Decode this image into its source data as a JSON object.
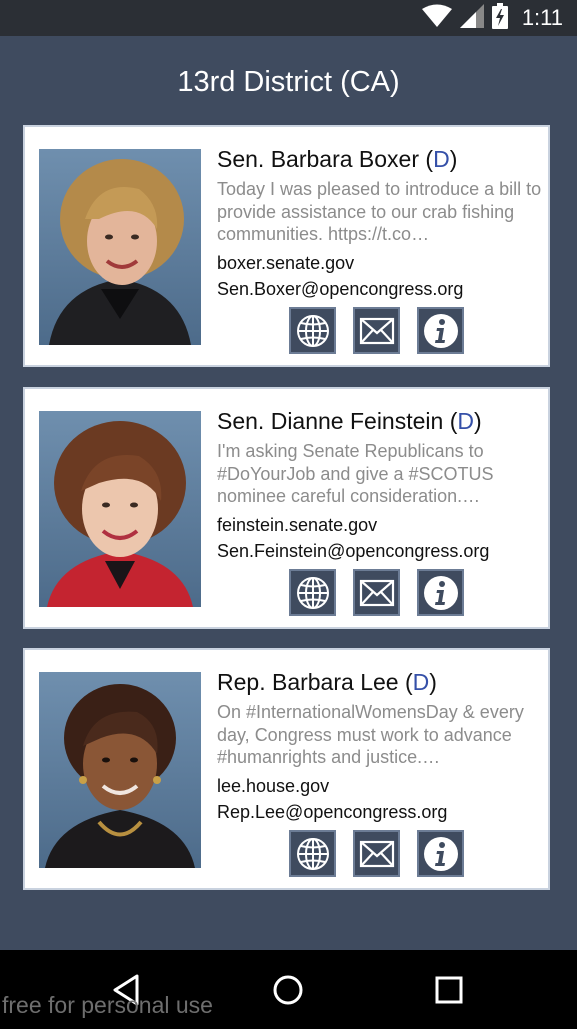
{
  "status_bar": {
    "time": "1:11",
    "icons": [
      "wifi-icon",
      "signal-icon",
      "battery-charging-icon"
    ]
  },
  "header": {
    "title": "13rd District (CA)"
  },
  "representatives": [
    {
      "name": "Sen. Barbara Boxer",
      "party_open": "(",
      "party": "D",
      "party_close": ")",
      "tweet": "Today I was pleased to introduce a bill to provide assistance to our crab fishing communities. https://t.co…",
      "website": "boxer.senate.gov",
      "email": "Sen.Boxer@opencongress.org"
    },
    {
      "name": "Sen. Dianne Feinstein",
      "party_open": "(",
      "party": "D",
      "party_close": ")",
      "tweet": "I'm asking Senate Republicans to #DoYourJob and give a #SCOTUS nominee careful consideration.…",
      "website": "feinstein.senate.gov",
      "email": "Sen.Feinstein@opencongress.org"
    },
    {
      "name": "Rep. Barbara Lee",
      "party_open": "(",
      "party": "D",
      "party_close": ")",
      "tweet": "On #InternationalWomensDay & every day, Congress must work to advance #humanrights and justice.…",
      "website": "lee.house.gov",
      "email": "Rep.Lee@opencongress.org"
    }
  ],
  "action_icons": [
    "globe-icon",
    "envelope-icon",
    "info-icon"
  ],
  "nav_bar": {
    "icons": [
      "back-triangle-icon",
      "home-circle-icon",
      "recents-square-icon"
    ]
  },
  "watermark": "free for personal use",
  "colors": {
    "background": "#3f4b5f",
    "party_democrat": "#3550a8",
    "status_bar": "#2b2f35",
    "nav_bar": "#000000"
  }
}
